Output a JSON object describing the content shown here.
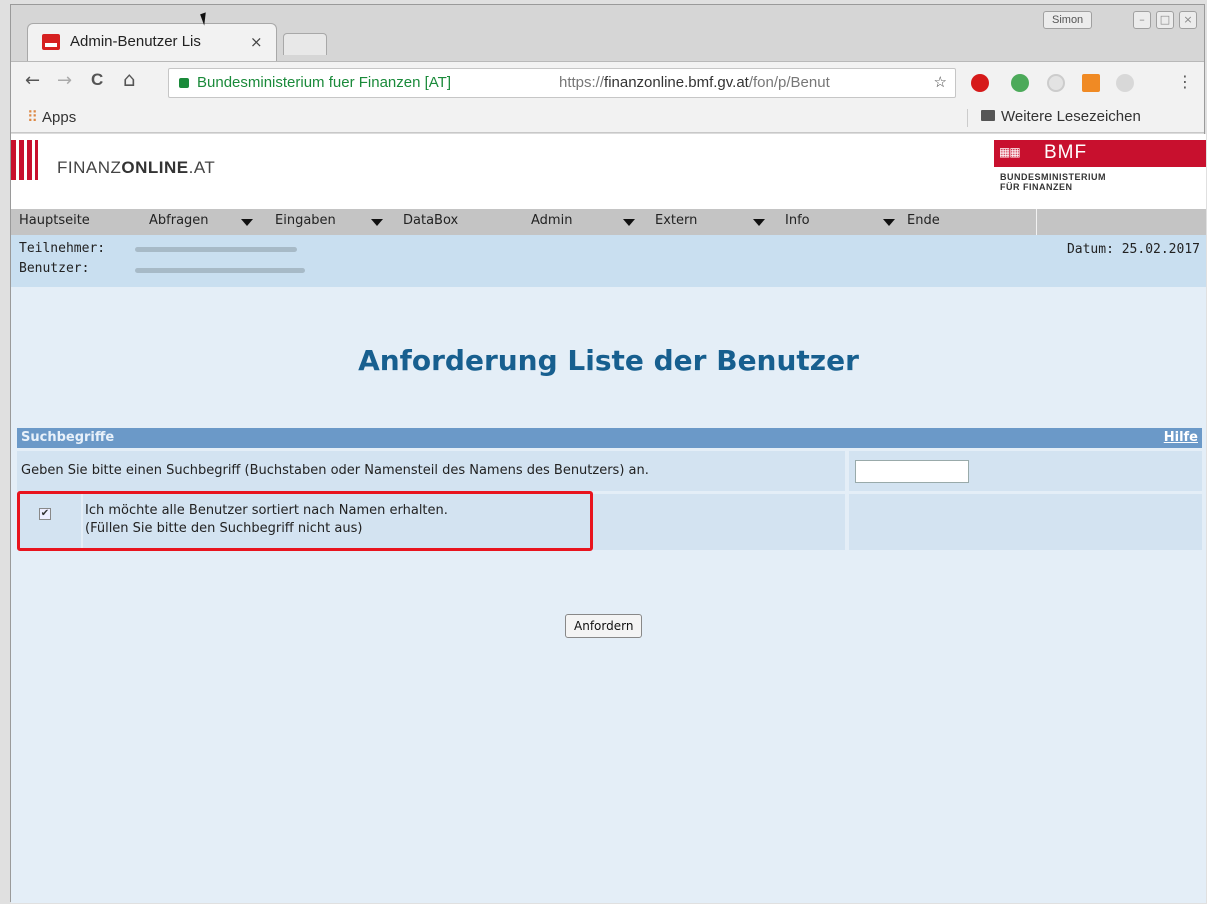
{
  "browser": {
    "tab_title": "Admin-Benutzer Lis",
    "tab_close": "×",
    "profile_name": "Simon",
    "window_min": "–",
    "window_max": "□",
    "window_close": "×",
    "nav_back": "←",
    "nav_forward": "→",
    "nav_reload": "C",
    "nav_home": "⌂",
    "cert_org": "Bundesministerium fuer Finanzen [AT]",
    "url_scheme": "https://",
    "url_host": "finanzonline.bmf.gv.at",
    "url_path": "/fon/p/Benut",
    "star": "☆",
    "menu": "⋮",
    "bookmarks": {
      "apps_label": "Apps",
      "other_label": "Weitere Lesezeichen"
    },
    "icons": [
      "apps-grid-icon",
      "folder-icon",
      "lock-icon",
      "star-icon",
      "adblock-icon",
      "extension-icon"
    ]
  },
  "brand": {
    "site_prefix": "FINANZ",
    "site_bold": "ONLINE",
    "site_suffix": ".AT",
    "bmf_text": "BMF",
    "bmf_sub_line1": "BUNDESMINISTERIUM",
    "bmf_sub_line2": "FÜR FINANZEN",
    "accent": "#c8102e"
  },
  "nav": {
    "items": [
      {
        "label": "Hauptseite",
        "dropdown": false
      },
      {
        "label": "Abfragen",
        "dropdown": true
      },
      {
        "label": "Eingaben",
        "dropdown": true
      },
      {
        "label": "DataBox",
        "dropdown": false
      },
      {
        "label": "Admin",
        "dropdown": true
      },
      {
        "label": "Extern",
        "dropdown": true
      },
      {
        "label": "Info",
        "dropdown": true
      },
      {
        "label": "Ende",
        "dropdown": false
      }
    ]
  },
  "userinfo": {
    "teilnehmer_label": "Teilnehmer:",
    "benutzer_label": "Benutzer:",
    "datum": "Datum: 25.02.2017"
  },
  "main": {
    "heading": "Anforderung Liste der Benutzer",
    "section_title": "Suchbegriffe",
    "help_link": "Hilfe",
    "search_prompt": "Geben Sie bitte einen Suchbegriff (Buchstaben oder Namensteil des Namens des Benutzers) an.",
    "search_value": "",
    "checkbox_checked": true,
    "checkbox_line1": "Ich möchte alle Benutzer sortiert nach Namen erhalten.",
    "checkbox_line2": "(Füllen Sie bitte den Suchbegriff nicht aus)",
    "submit_label": "Anfordern",
    "heading_color": "#175f8f",
    "section_color": "#6b99c8",
    "highlight_color": "#e8141e"
  }
}
